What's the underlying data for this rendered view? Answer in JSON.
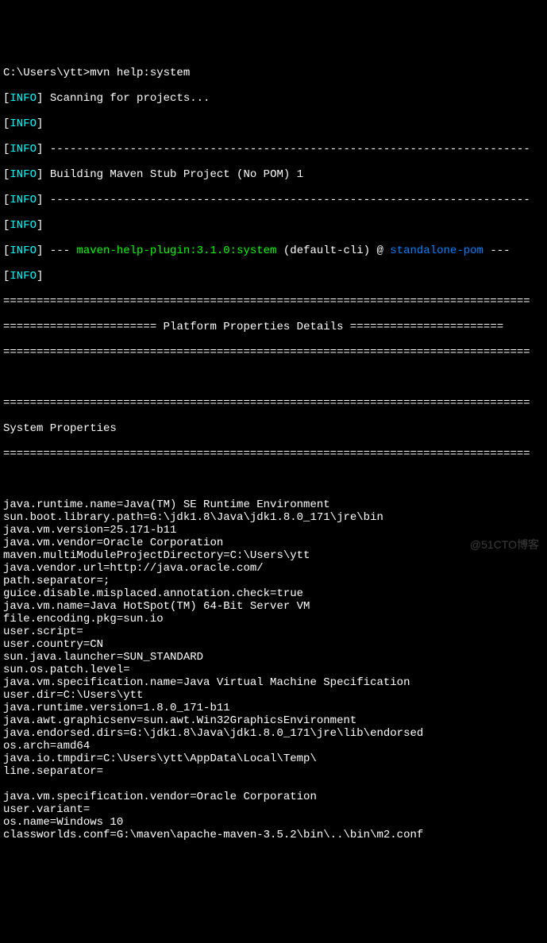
{
  "prompt": "C:\\Users\\ytt>mvn help:system",
  "info_label": "INFO",
  "scan_msg": " Scanning for projects...",
  "hr": " ------------------------------------------------------------------------",
  "building": " Building Maven Stub Project (No POM) 1",
  "dash3": " --- ",
  "plugin": "maven-help-plugin:3.1.0:system",
  "default_cli": " (default-cli) @ ",
  "pom": "standalone-pom",
  "dash_end": " ---",
  "eq_full": "===============================================================================",
  "eq_left": "======================= ",
  "platform_title": "Platform Properties Details",
  "eq_right": " =======================",
  "sys_header": "System Properties",
  "props": [
    "java.runtime.name=Java(TM) SE Runtime Environment",
    "sun.boot.library.path=G:\\jdk1.8\\Java\\jdk1.8.0_171\\jre\\bin",
    "java.vm.version=25.171-b11",
    "java.vm.vendor=Oracle Corporation",
    "maven.multiModuleProjectDirectory=C:\\Users\\ytt",
    "java.vendor.url=http://java.oracle.com/",
    "path.separator=;",
    "guice.disable.misplaced.annotation.check=true",
    "java.vm.name=Java HotSpot(TM) 64-Bit Server VM",
    "file.encoding.pkg=sun.io",
    "user.script=",
    "user.country=CN",
    "sun.java.launcher=SUN_STANDARD",
    "sun.os.patch.level=",
    "java.vm.specification.name=Java Virtual Machine Specification",
    "user.dir=C:\\Users\\ytt",
    "java.runtime.version=1.8.0_171-b11",
    "java.awt.graphicsenv=sun.awt.Win32GraphicsEnvironment",
    "java.endorsed.dirs=G:\\jdk1.8\\Java\\jdk1.8.0_171\\jre\\lib\\endorsed",
    "os.arch=amd64",
    "java.io.tmpdir=C:\\Users\\ytt\\AppData\\Local\\Temp\\",
    "line.separator=",
    "",
    "java.vm.specification.vendor=Oracle Corporation",
    "user.variant=",
    "os.name=Windows 10",
    "classworlds.conf=G:\\maven\\apache-maven-3.5.2\\bin\\..\\bin\\m2.conf"
  ],
  "watermark": "@51CTO博客"
}
